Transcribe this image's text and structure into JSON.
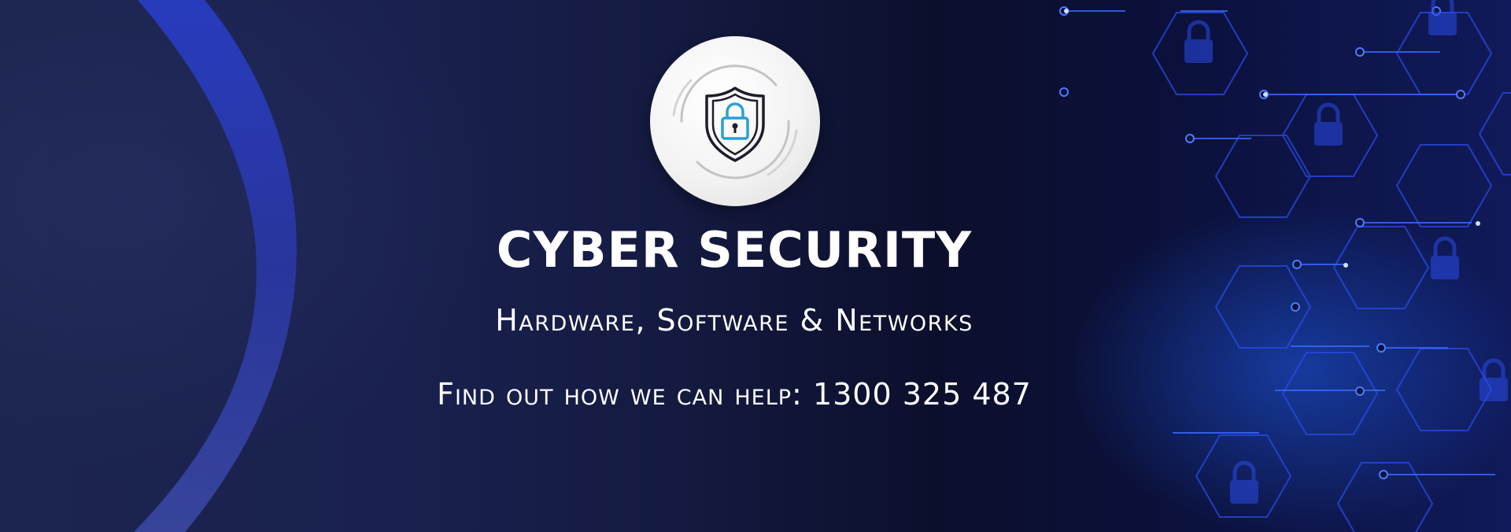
{
  "banner": {
    "title": "CYBER SECURITY",
    "subtitle": "Hardware, Software & Networks",
    "cta_label": "Find out how we can help:",
    "phone": "1300 325 487"
  },
  "logo": {
    "icon": "shield-lock-icon",
    "accent_color": "#2a9fd6"
  },
  "background": {
    "base_color": "#141a3e",
    "accent_color": "#2f4fd8",
    "decoration": "hexagon-circuit-pattern"
  }
}
